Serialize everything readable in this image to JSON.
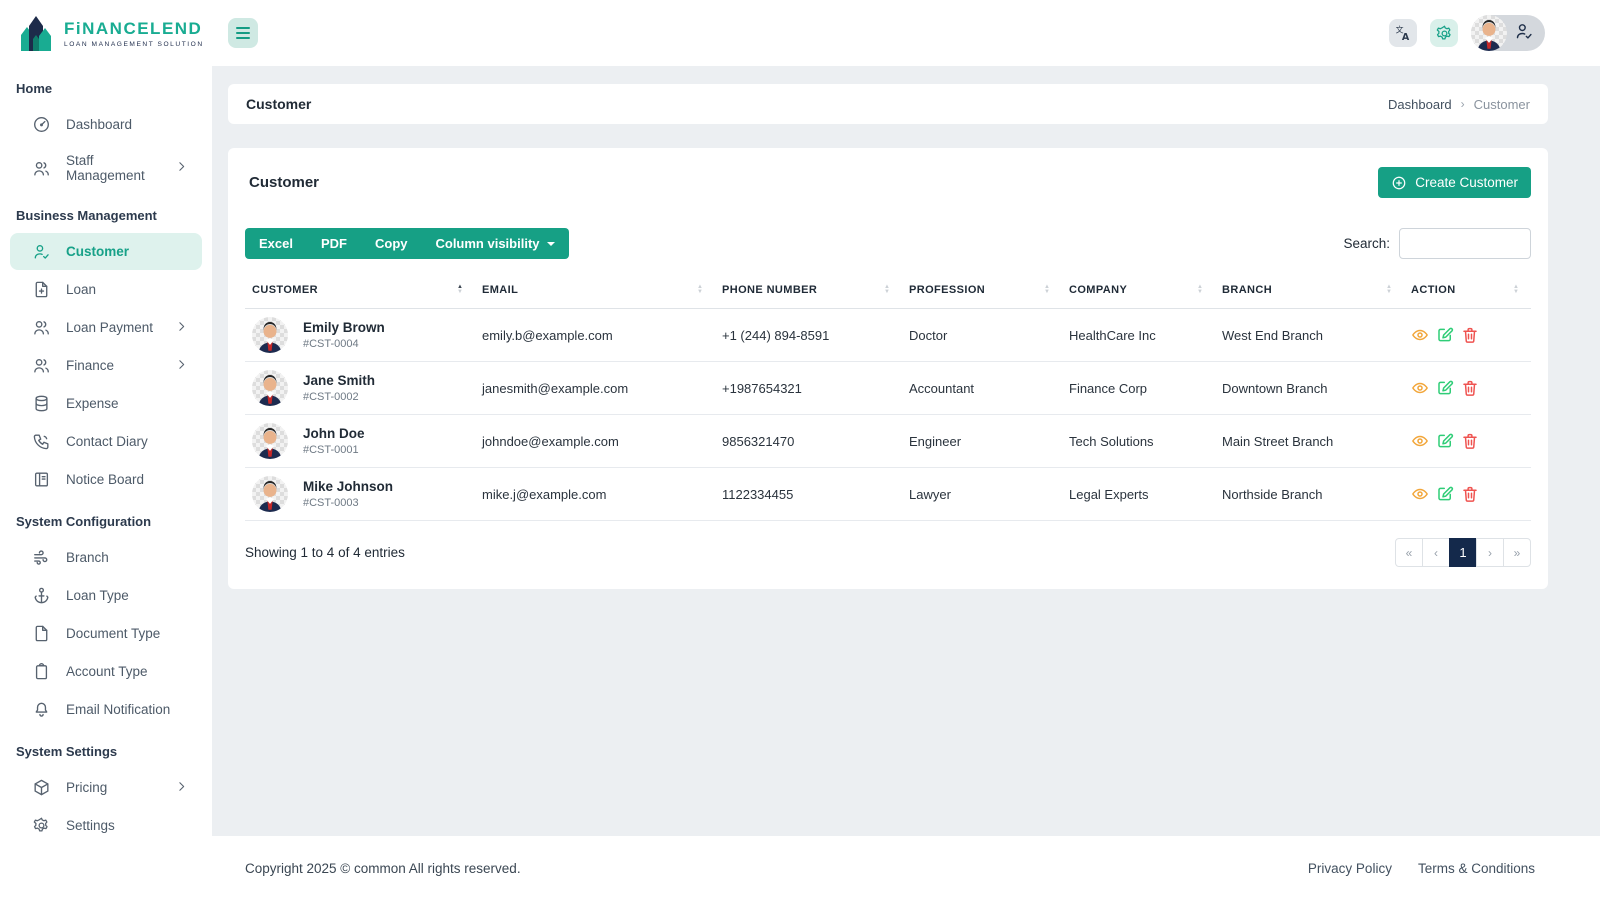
{
  "brand": {
    "name": "FiNANCELEND",
    "tagline": "LOAN MANAGEMENT SOLUTION"
  },
  "colors": {
    "accent": "#16a085",
    "accent_light": "#def2ed",
    "navy": "#14294b",
    "view_icon": "#f2a63a",
    "edit_icon": "#2fcd77",
    "delete_icon": "#ef5350"
  },
  "icons": {
    "menu": "hamburger",
    "translate": "文A",
    "settings": "gear",
    "profile_badge": "user-check",
    "create": "plus-circle",
    "view": "eye",
    "edit": "pencil-square",
    "delete": "trash"
  },
  "sidebar": {
    "sections": [
      {
        "title": "Home",
        "items": [
          {
            "label": "Dashboard"
          },
          {
            "label": "Staff Management",
            "has_submenu": true
          }
        ]
      },
      {
        "title": "Business Management",
        "items": [
          {
            "label": "Customer",
            "active": true
          },
          {
            "label": "Loan"
          },
          {
            "label": "Loan Payment",
            "has_submenu": true
          },
          {
            "label": "Finance",
            "has_submenu": true
          },
          {
            "label": "Expense"
          },
          {
            "label": "Contact Diary"
          },
          {
            "label": "Notice Board"
          }
        ]
      },
      {
        "title": "System Configuration",
        "items": [
          {
            "label": "Branch"
          },
          {
            "label": "Loan Type"
          },
          {
            "label": "Document Type"
          },
          {
            "label": "Account Type"
          },
          {
            "label": "Email Notification"
          }
        ]
      },
      {
        "title": "System Settings",
        "items": [
          {
            "label": "Pricing",
            "has_submenu": true
          },
          {
            "label": "Settings"
          }
        ]
      }
    ]
  },
  "page": {
    "title": "Customer",
    "breadcrumb": [
      "Dashboard",
      "Customer"
    ],
    "breadcrumb_separator": "›"
  },
  "customer_card": {
    "title": "Customer",
    "create_button": "Create Customer",
    "export_buttons": [
      "Excel",
      "PDF",
      "Copy"
    ],
    "column_visibility_button": "Column visibility",
    "search_label": "Search:",
    "search_value": ""
  },
  "table": {
    "headers": [
      "CUSTOMER",
      "EMAIL",
      "PHONE NUMBER",
      "PROFESSION",
      "COMPANY",
      "BRANCH",
      "ACTION"
    ],
    "rows": [
      {
        "name": "Emily Brown",
        "id": "#CST-0004",
        "email": "emily.b@example.com",
        "phone": "+1 (244) 894-8591",
        "profession": "Doctor",
        "company": "HealthCare Inc",
        "branch": "West End Branch"
      },
      {
        "name": "Jane Smith",
        "id": "#CST-0002",
        "email": "janesmith@example.com",
        "phone": "+1987654321",
        "profession": "Accountant",
        "company": "Finance Corp",
        "branch": "Downtown Branch"
      },
      {
        "name": "John Doe",
        "id": "#CST-0001",
        "email": "johndoe@example.com",
        "phone": "9856321470",
        "profession": "Engineer",
        "company": "Tech Solutions",
        "branch": "Main Street Branch"
      },
      {
        "name": "Mike Johnson",
        "id": "#CST-0003",
        "email": "mike.j@example.com",
        "phone": "1122334455",
        "profession": "Lawyer",
        "company": "Legal Experts",
        "branch": "Northside Branch"
      }
    ],
    "info": "Showing 1 to 4 of 4 entries",
    "pagination": {
      "first": "«",
      "prev": "‹",
      "pages": [
        "1"
      ],
      "active_page": "1",
      "next": "›",
      "last": "»"
    }
  },
  "footer": {
    "copyright": "Copyright 2025 © common All rights reserved.",
    "links": [
      "Privacy Policy",
      "Terms & Conditions"
    ]
  }
}
